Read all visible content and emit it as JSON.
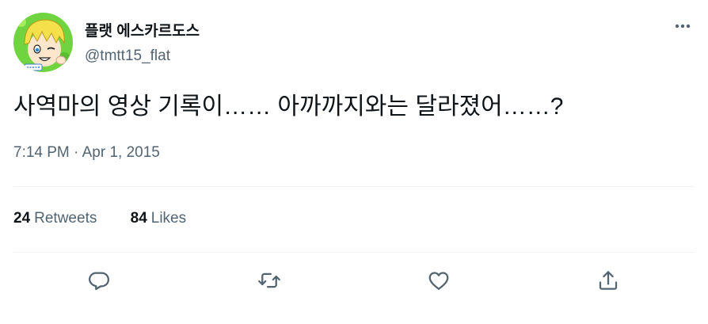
{
  "tweet": {
    "display_name": "플랫 에스카르도스",
    "handle": "@tmtt15_flat",
    "text": "사역마의 영상 기록이…… 아까까지와는 달라졌어……?",
    "timestamp": "7:14 PM · Apr 1, 2015"
  },
  "stats": {
    "retweets_count": "24",
    "retweets_label": "Retweets",
    "likes_count": "84",
    "likes_label": "Likes"
  },
  "icons": {
    "more": "more-horizontal-icon",
    "reply": "reply-bubble-icon",
    "retweet": "retweet-arrows-icon",
    "like": "heart-icon",
    "share": "share-upload-icon"
  },
  "colors": {
    "text_primary": "#0f1419",
    "text_secondary": "#536471",
    "divider": "#eff3f4",
    "avatar_bg": "#6fd43f"
  }
}
